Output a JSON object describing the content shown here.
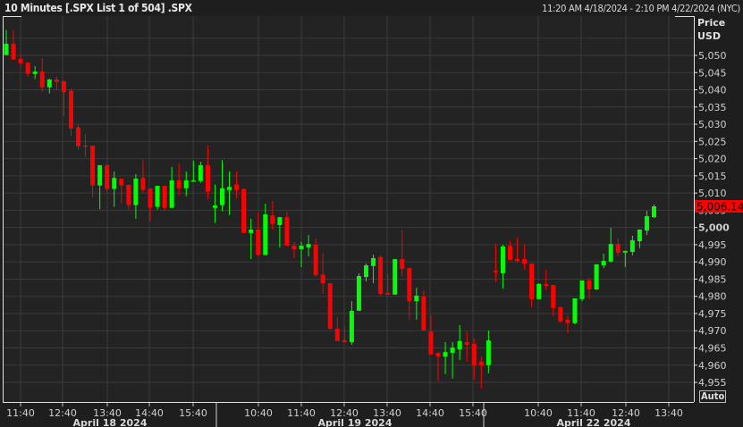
{
  "header": {
    "title": "10 Minutes [.SPX List 1 of 504] .SPX",
    "range": "11:20 AM 4/18/2024 - 2:10 PM 4/22/2024 (NYC)"
  },
  "axis": {
    "price_label": "Price",
    "currency_label": "USD",
    "auto_button": "Auto"
  },
  "last_price": "5,006.14",
  "colors": {
    "up": "#00ff00",
    "down": "#ff0000",
    "last_price_bg": "#ff0000",
    "background": "#1e1e1e",
    "plot": "#222322",
    "grid": "#3a3b3a"
  },
  "chart_data": {
    "type": "candlestick",
    "interval": "10 Minutes",
    "symbol": ".SPX",
    "ylim": [
      4950,
      5058
    ],
    "yticks": [
      4955,
      4960,
      4965,
      4970,
      4975,
      4980,
      4985,
      4990,
      4995,
      5000,
      5005,
      5010,
      5015,
      5020,
      5025,
      5030,
      5035,
      5040,
      5045,
      5050
    ],
    "ytick_labels": [
      "4,955",
      "4,960",
      "4,965",
      "4,970",
      "4,975",
      "4,980",
      "4,985",
      "4,990",
      "4,995",
      "5,000",
      "5,005",
      "5,010",
      "5,015",
      "5,020",
      "5,025",
      "5,030",
      "5,035",
      "5,040",
      "5,045",
      "5,050"
    ],
    "xtick_labels": [
      "11:40",
      "12:40",
      "13:40",
      "14:40",
      "15:40",
      "10:40",
      "11:40",
      "12:40",
      "13:40",
      "14:40",
      "15:40",
      "10:40",
      "11:40",
      "12:40",
      "13:40"
    ],
    "date_labels": [
      "April 18 2024",
      "April 19 2024",
      "April 22 2024"
    ],
    "grid": true,
    "ohlc_fields": [
      "open",
      "high",
      "low",
      "close"
    ],
    "ohlc": [
      [
        5050.1,
        5057.4,
        5050.1,
        5053.4
      ],
      [
        5053.4,
        5057.4,
        5048.8,
        5048.8
      ],
      [
        5049.0,
        5050.5,
        5046.4,
        5047.7
      ],
      [
        5047.9,
        5047.9,
        5043.9,
        5044.6
      ],
      [
        5044.6,
        5046.9,
        5043.1,
        5045.3
      ],
      [
        5045.3,
        5049.2,
        5039.4,
        5040.7
      ],
      [
        5040.7,
        5043.2,
        5038.9,
        5043.0
      ],
      [
        5043.0,
        5043.9,
        5040.0,
        5042.3
      ],
      [
        5042.5,
        5042.7,
        5032.3,
        5039.4
      ],
      [
        5039.7,
        5040.4,
        5026.7,
        5028.8
      ],
      [
        5029.1,
        5029.9,
        5022.6,
        5023.6
      ],
      [
        5023.8,
        5027.2,
        5020.5,
        5023.6
      ],
      [
        5023.8,
        5023.8,
        5008.7,
        5012.2
      ],
      [
        5012.2,
        5018.1,
        5005.3,
        5018.1
      ],
      [
        5018.1,
        5018.5,
        5010.1,
        5011.2
      ],
      [
        5011.2,
        5016.3,
        5006.0,
        5014.4
      ],
      [
        5014.2,
        5014.2,
        5007.0,
        5012.2
      ],
      [
        5012.4,
        5012.4,
        5005.3,
        5006.5
      ],
      [
        5006.5,
        5015.5,
        5002.5,
        5014.2
      ],
      [
        5014.4,
        5019.6,
        5010.1,
        5010.9
      ],
      [
        5011.3,
        5011.3,
        5001.9,
        5005.7
      ],
      [
        5006.0,
        5012.1,
        5005.2,
        5012.1
      ],
      [
        5012.1,
        5012.1,
        5004.9,
        5005.7
      ],
      [
        5005.7,
        5017.6,
        5005.7,
        5013.7
      ],
      [
        5013.7,
        5018.6,
        5009.3,
        5011.4
      ],
      [
        5011.4,
        5016.3,
        5009.1,
        5013.7
      ],
      [
        5013.5,
        5019.4,
        5013.5,
        5013.7
      ],
      [
        5013.5,
        5019.1,
        5013.0,
        5018.1
      ],
      [
        5018.1,
        5023.8,
        5008.3,
        5010.4
      ],
      [
        5005.7,
        5012.5,
        5001.3,
        5006.4
      ],
      [
        5006.5,
        5019.6,
        5004.7,
        5011.4
      ],
      [
        5010.9,
        5016.3,
        5003.6,
        5011.8
      ],
      [
        5012.5,
        5016.3,
        5008.4,
        5010.9
      ],
      [
        5011.2,
        5011.3,
        4998.4,
        4998.4
      ],
      [
        4998.4,
        5002.5,
        4990.8,
        4999.4
      ],
      [
        4999.4,
        5004.3,
        4991.7,
        4992.0
      ],
      [
        4992.0,
        5006.9,
        4992.0,
        5003.8
      ],
      [
        5003.5,
        5007.7,
        4999.4,
        5001.0
      ],
      [
        5000.7,
        5003.0,
        4994.2,
        5003.0
      ],
      [
        5003.0,
        5004.6,
        4994.7,
        4994.7
      ],
      [
        4994.7,
        4995.8,
        4991.1,
        4993.7
      ],
      [
        4993.7,
        4995.8,
        4988.5,
        4994.7
      ],
      [
        4994.2,
        4997.8,
        4991.6,
        4995.2
      ],
      [
        4995.0,
        4996.8,
        4985.6,
        4986.2
      ],
      [
        4986.3,
        4992.6,
        4980.7,
        4983.8
      ],
      [
        4983.8,
        4983.8,
        4970.3,
        4970.6
      ],
      [
        4970.6,
        4974.0,
        4967.0,
        4967.0
      ],
      [
        4967.2,
        4971.4,
        4966.7,
        4966.7
      ],
      [
        4966.7,
        4978.6,
        4965.9,
        4975.8
      ],
      [
        4975.8,
        4986.7,
        4975.8,
        4985.9
      ],
      [
        4985.6,
        4989.5,
        4984.3,
        4989.0
      ],
      [
        4988.8,
        4992.1,
        4983.8,
        4991.1
      ],
      [
        4991.4,
        4991.9,
        4980.2,
        4980.7
      ],
      [
        4981.0,
        4986.4,
        4980.5,
        4980.5
      ],
      [
        4980.5,
        4990.8,
        4980.5,
        4990.8
      ],
      [
        4990.8,
        4999.4,
        4985.9,
        4988.0
      ],
      [
        4988.2,
        4988.2,
        4973.2,
        4978.6
      ],
      [
        4978.6,
        4982.5,
        4973.2,
        4980.2
      ],
      [
        4979.9,
        4981.8,
        4970.1,
        4970.1
      ],
      [
        4969.8,
        4974.5,
        4963.1,
        4963.1
      ],
      [
        4963.6,
        4963.6,
        4955.3,
        4962.5
      ],
      [
        4962.5,
        4966.7,
        4957.4,
        4963.8
      ],
      [
        4963.6,
        4966.7,
        4956.1,
        4965.1
      ],
      [
        4964.6,
        4971.6,
        4961.5,
        4967.0
      ],
      [
        4966.7,
        4969.8,
        4961.0,
        4965.9
      ],
      [
        4966.2,
        4967.7,
        4955.8,
        4960.0
      ],
      [
        4961.0,
        4962.5,
        4953.2,
        4960.0
      ],
      [
        4960.0,
        4970.1,
        4957.6,
        4967.2
      ],
      [
        4987.5,
        4995.2,
        4984.1,
        4987.0
      ],
      [
        4986.7,
        4995.0,
        4982.3,
        4994.5
      ],
      [
        4994.7,
        4996.0,
        4990.6,
        4990.6
      ],
      [
        4990.8,
        4997.1,
        4989.8,
        4990.3
      ],
      [
        4990.8,
        4995.0,
        4987.7,
        4989.5
      ],
      [
        4989.5,
        4989.5,
        4976.8,
        4979.2
      ],
      [
        4979.2,
        4983.8,
        4979.2,
        4983.6
      ],
      [
        4983.6,
        4987.7,
        4981.8,
        4983.0
      ],
      [
        4983.3,
        4983.3,
        4974.2,
        4976.6
      ],
      [
        4976.8,
        4977.1,
        4972.2,
        4972.7
      ],
      [
        4973.2,
        4974.5,
        4969.3,
        4972.2
      ],
      [
        4972.2,
        4979.4,
        4971.9,
        4979.4
      ],
      [
        4979.2,
        4984.6,
        4978.6,
        4984.6
      ],
      [
        4984.6,
        4985.4,
        4979.2,
        4982.0
      ],
      [
        4982.0,
        4989.3,
        4981.8,
        4989.3
      ],
      [
        4989.0,
        4992.4,
        4988.2,
        4990.3
      ],
      [
        4990.1,
        4999.9,
        4989.8,
        4995.2
      ],
      [
        4995.2,
        4996.8,
        4991.6,
        4992.7
      ],
      [
        4992.7,
        4993.2,
        4988.5,
        4993.2
      ],
      [
        4992.9,
        4997.6,
        4991.9,
        4996.3
      ],
      [
        4996.0,
        4999.4,
        4994.0,
        4999.4
      ],
      [
        4999.1,
        5004.8,
        4997.8,
        5003.3
      ],
      [
        5003.0,
        5006.7,
        5002.8,
        5006.14
      ]
    ],
    "last_value": 5006.14
  }
}
